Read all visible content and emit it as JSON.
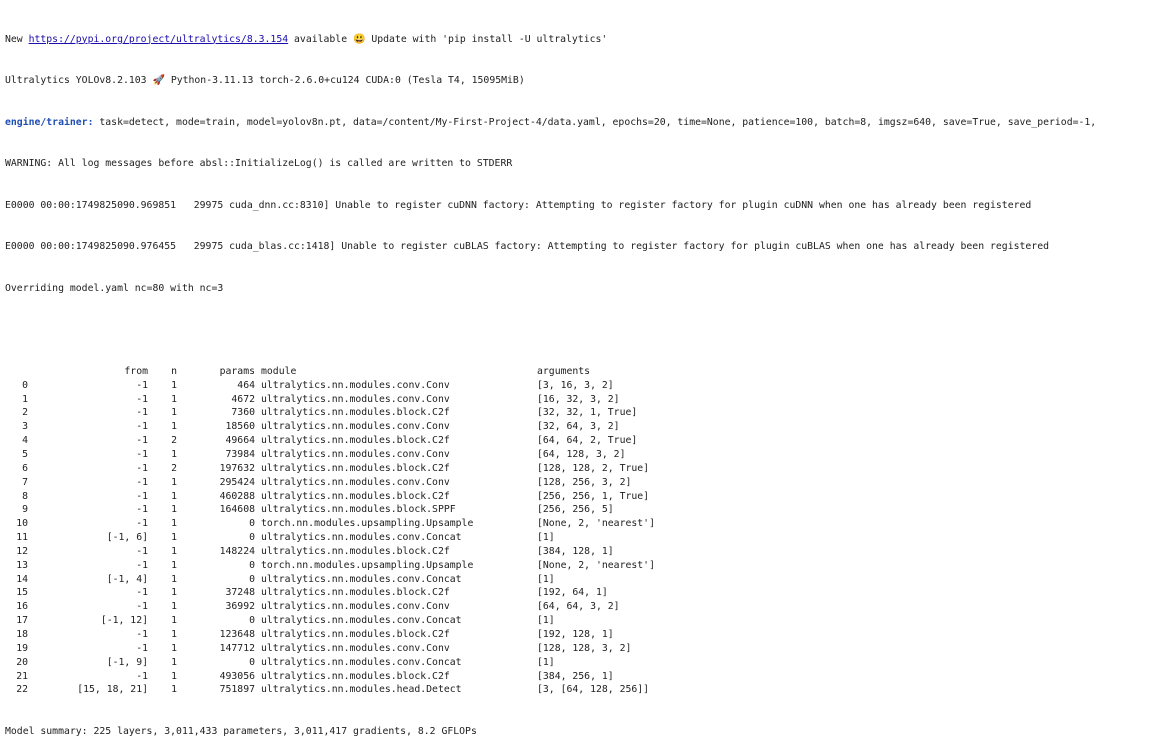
{
  "header": {
    "update_prefix": "New ",
    "update_link": "https://pypi.org/project/ultralytics/8.3.154",
    "update_suffix": " available ",
    "update_emoji": "😃",
    "update_tail": " Update with 'pip install -U ultralytics'",
    "version_part1": "Ultralytics YOLOv8.2.103 ",
    "version_emoji": "🚀",
    "version_part2": " Python-3.11.13 torch-2.6.0+cu124 CUDA:0 (Tesla T4, 15095MiB)",
    "trainer_label": "engine/trainer:",
    "trainer_args": " task=detect, mode=train, model=yolov8n.pt, data=/content/My-First-Project-4/data.yaml, epochs=20, time=None, patience=100, batch=8, imgsz=640, save=True, save_period=-1,",
    "warning": "WARNING: All log messages before absl::InitializeLog() is called are written to STDERR",
    "err1": "E0000 00:00:1749825090.969851   29975 cuda_dnn.cc:8310] Unable to register cuDNN factory: Attempting to register factory for plugin cuDNN when one has already been registered",
    "err2": "E0000 00:00:1749825090.976455   29975 cuda_blas.cc:1418] Unable to register cuBLAS factory: Attempting to register factory for plugin cuBLAS when one has already been registered",
    "override": "Overriding model.yaml nc=80 with nc=3"
  },
  "table": {
    "columns": [
      "",
      "from",
      "n",
      "params",
      "module",
      "arguments"
    ],
    "rows": [
      [
        "0",
        "-1",
        "1",
        "464",
        "ultralytics.nn.modules.conv.Conv",
        "[3, 16, 3, 2]"
      ],
      [
        "1",
        "-1",
        "1",
        "4672",
        "ultralytics.nn.modules.conv.Conv",
        "[16, 32, 3, 2]"
      ],
      [
        "2",
        "-1",
        "1",
        "7360",
        "ultralytics.nn.modules.block.C2f",
        "[32, 32, 1, True]"
      ],
      [
        "3",
        "-1",
        "1",
        "18560",
        "ultralytics.nn.modules.conv.Conv",
        "[32, 64, 3, 2]"
      ],
      [
        "4",
        "-1",
        "2",
        "49664",
        "ultralytics.nn.modules.block.C2f",
        "[64, 64, 2, True]"
      ],
      [
        "5",
        "-1",
        "1",
        "73984",
        "ultralytics.nn.modules.conv.Conv",
        "[64, 128, 3, 2]"
      ],
      [
        "6",
        "-1",
        "2",
        "197632",
        "ultralytics.nn.modules.block.C2f",
        "[128, 128, 2, True]"
      ],
      [
        "7",
        "-1",
        "1",
        "295424",
        "ultralytics.nn.modules.conv.Conv",
        "[128, 256, 3, 2]"
      ],
      [
        "8",
        "-1",
        "1",
        "460288",
        "ultralytics.nn.modules.block.C2f",
        "[256, 256, 1, True]"
      ],
      [
        "9",
        "-1",
        "1",
        "164608",
        "ultralytics.nn.modules.block.SPPF",
        "[256, 256, 5]"
      ],
      [
        "10",
        "-1",
        "1",
        "0",
        "torch.nn.modules.upsampling.Upsample",
        "[None, 2, 'nearest']"
      ],
      [
        "11",
        "[-1, 6]",
        "1",
        "0",
        "ultralytics.nn.modules.conv.Concat",
        "[1]"
      ],
      [
        "12",
        "-1",
        "1",
        "148224",
        "ultralytics.nn.modules.block.C2f",
        "[384, 128, 1]"
      ],
      [
        "13",
        "-1",
        "1",
        "0",
        "torch.nn.modules.upsampling.Upsample",
        "[None, 2, 'nearest']"
      ],
      [
        "14",
        "[-1, 4]",
        "1",
        "0",
        "ultralytics.nn.modules.conv.Concat",
        "[1]"
      ],
      [
        "15",
        "-1",
        "1",
        "37248",
        "ultralytics.nn.modules.block.C2f",
        "[192, 64, 1]"
      ],
      [
        "16",
        "-1",
        "1",
        "36992",
        "ultralytics.nn.modules.conv.Conv",
        "[64, 64, 3, 2]"
      ],
      [
        "17",
        "[-1, 12]",
        "1",
        "0",
        "ultralytics.nn.modules.conv.Concat",
        "[1]"
      ],
      [
        "18",
        "-1",
        "1",
        "123648",
        "ultralytics.nn.modules.block.C2f",
        "[192, 128, 1]"
      ],
      [
        "19",
        "-1",
        "1",
        "147712",
        "ultralytics.nn.modules.conv.Conv",
        "[128, 128, 3, 2]"
      ],
      [
        "20",
        "[-1, 9]",
        "1",
        "0",
        "ultralytics.nn.modules.conv.Concat",
        "[1]"
      ],
      [
        "21",
        "-1",
        "1",
        "493056",
        "ultralytics.nn.modules.block.C2f",
        "[384, 256, 1]"
      ],
      [
        "22",
        "[15, 18, 21]",
        "1",
        "751897",
        "ultralytics.nn.modules.head.Detect",
        "[3, [64, 128, 256]]"
      ]
    ]
  },
  "summary": "Model summary: 225 layers, 3,011,433 parameters, 3,011,417 gradients, 8.2 GFLOPs",
  "colors": {
    "link": "#1a0dab",
    "trainer_label": "#1f4fb3",
    "text": "#212121",
    "background": "#ffffff"
  }
}
